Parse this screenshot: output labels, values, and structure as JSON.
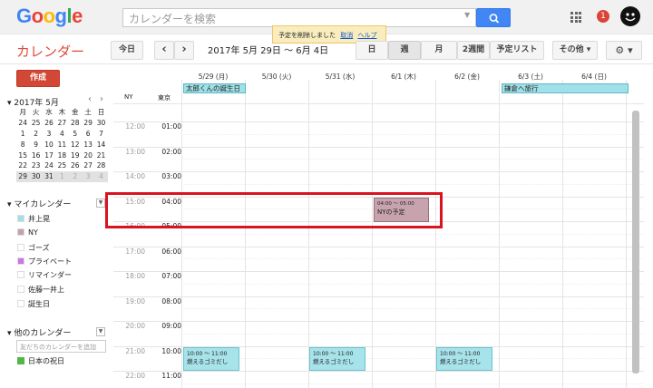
{
  "header": {
    "logo_text": "Google",
    "search_placeholder": "カレンダーを検索",
    "notification_count": "1",
    "toast": {
      "message": "予定を削除しました",
      "undo": "取消",
      "help": "ヘルプ"
    }
  },
  "toolbar": {
    "app_title": "カレンダー",
    "today": "今日",
    "prev": "‹",
    "next": "›",
    "date_range": "2017年 5月 29日 ～ 6月 4日",
    "view_day": "日",
    "view_week": "週",
    "view_month": "月",
    "view_2week": "2週間",
    "view_agenda": "予定リスト",
    "more": "その他 ▾",
    "settings": "⚙ ▾"
  },
  "sidebar": {
    "create": "作成",
    "mini_title": "2017年 5月",
    "weekdays": [
      "月",
      "火",
      "水",
      "木",
      "金",
      "土",
      "日"
    ],
    "weeks": [
      [
        "24",
        "25",
        "26",
        "27",
        "28",
        "29",
        "30"
      ],
      [
        "1",
        "2",
        "3",
        "4",
        "5",
        "6",
        "7"
      ],
      [
        "8",
        "9",
        "10",
        "11",
        "12",
        "13",
        "14"
      ],
      [
        "15",
        "16",
        "17",
        "18",
        "19",
        "20",
        "21"
      ],
      [
        "22",
        "23",
        "24",
        "25",
        "26",
        "27",
        "28"
      ],
      [
        "29",
        "30",
        "31",
        "1",
        "2",
        "3",
        "4"
      ]
    ],
    "my_calendars_label": "マイカレンダー",
    "my_calendars": [
      {
        "name": "井上晃",
        "color": "#9fe1e7"
      },
      {
        "name": "NY",
        "color": "#c2a1a9"
      },
      {
        "name": "ゴーズ",
        "color": "#ffffff"
      },
      {
        "name": "プライベート",
        "color": "#cd74e6"
      },
      {
        "name": "リマインダー",
        "color": "#ffffff"
      },
      {
        "name": "佐藤一井上",
        "color": "#ffffff"
      },
      {
        "name": "誕生日",
        "color": "#ffffff"
      }
    ],
    "other_calendars_label": "他のカレンダー",
    "friend_placeholder": "友だちのカレンダーを追加",
    "other_calendars": [
      {
        "name": "日本の祝日",
        "color": "#51b749"
      }
    ]
  },
  "grid": {
    "tz_ny": "NY",
    "tz_tokyo": "東京",
    "days": [
      "5/29 (月)",
      "5/30 (火)",
      "5/31 (水)",
      "6/1 (木)",
      "6/2 (金)",
      "6/3 (土)",
      "6/4 (日)"
    ],
    "ny_times": [
      "12:00",
      "13:00",
      "14:00",
      "15:00",
      "16:00",
      "17:00",
      "18:00",
      "19:00",
      "20:00",
      "21:00",
      "22:00"
    ],
    "tokyo_times": [
      "01:00",
      "02:00",
      "03:00",
      "04:00",
      "05:00",
      "06:00",
      "07:00",
      "08:00",
      "09:00",
      "10:00",
      "11:00"
    ],
    "allday": [
      {
        "title": "太郎くんの誕生日"
      },
      {
        "title": "鎌倉へ旅行"
      }
    ],
    "ny_event": {
      "time": "04:00 ～ 05:00",
      "title": "NYの予定"
    },
    "events": [
      {
        "time": "10:00 ～ 11:00",
        "title": "燃えるゴミだし"
      },
      {
        "time": "10:00 ～ 11:00",
        "title": "燃えるゴミだし"
      },
      {
        "time": "10:00 ～ 11:00",
        "title": "燃えるゴミだし"
      }
    ]
  }
}
